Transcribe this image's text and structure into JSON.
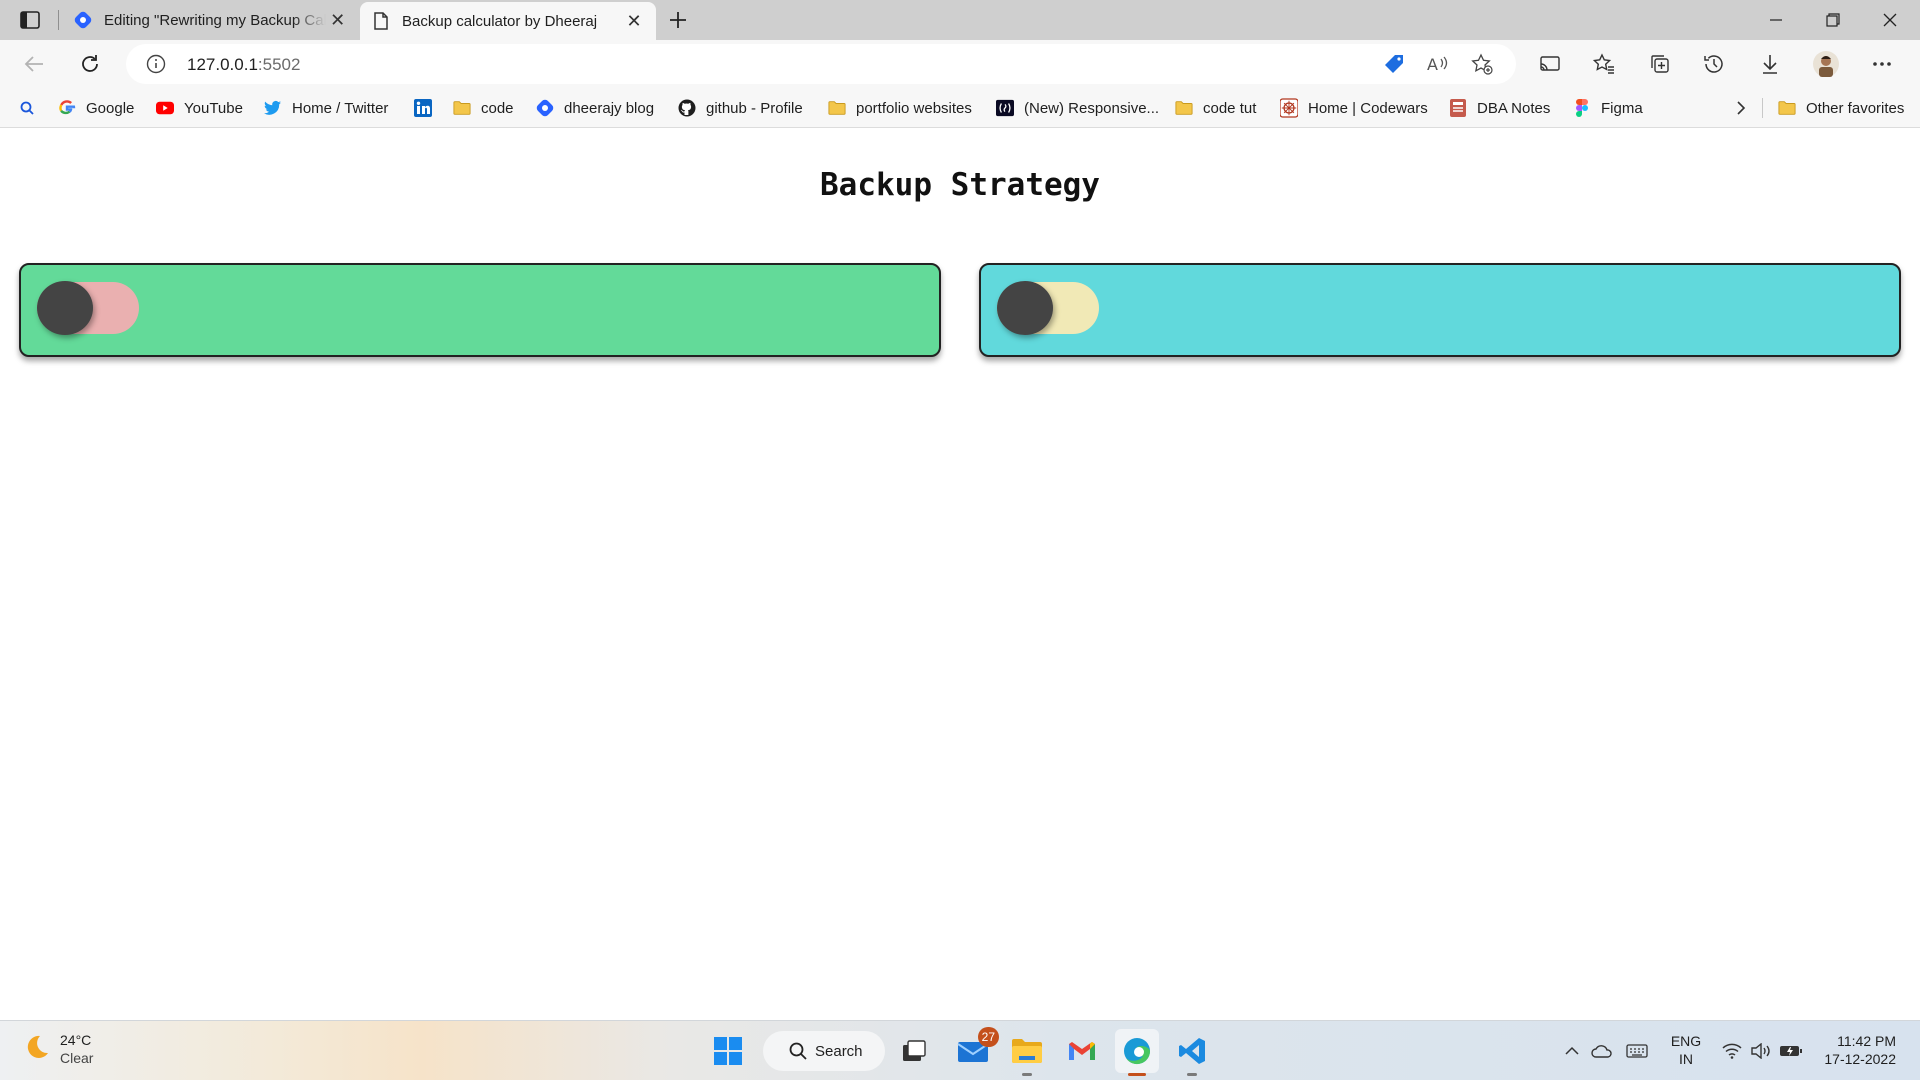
{
  "browser": {
    "tabs": [
      {
        "title": "Editing \"Rewriting my Backup Calculator\"",
        "favicon": "hashnode-icon",
        "active": false
      },
      {
        "title": "Backup calculator by Dheeraj",
        "favicon": "page-icon",
        "active": true
      }
    ],
    "address": {
      "host": "127.0.0.1",
      "port": ":5502"
    },
    "favorites": [
      {
        "label": "",
        "icon": "search-icon"
      },
      {
        "label": "Google",
        "icon": "google-icon"
      },
      {
        "label": "YouTube",
        "icon": "youtube-icon"
      },
      {
        "label": "Home / Twitter",
        "icon": "twitter-icon"
      },
      {
        "label": "",
        "icon": "linkedin-icon"
      },
      {
        "label": "code",
        "icon": "folder-icon"
      },
      {
        "label": "dheerajy blog",
        "icon": "hashnode-icon"
      },
      {
        "label": "github - Profile",
        "icon": "github-icon"
      },
      {
        "label": "portfolio websites",
        "icon": "folder-icon"
      },
      {
        "label": "(New) Responsive...",
        "icon": "freecodecamp-icon"
      },
      {
        "label": "code tut",
        "icon": "folder-icon"
      },
      {
        "label": "Home | Codewars",
        "icon": "codewars-icon"
      },
      {
        "label": "DBA Notes",
        "icon": "notes-icon"
      },
      {
        "label": "Figma",
        "icon": "figma-icon"
      }
    ],
    "other_favorites": "Other favorites"
  },
  "page": {
    "title": "Backup Strategy",
    "cards": [
      {
        "name": "card-left",
        "bg": "#63da99",
        "toggle_track": "#eab0b0",
        "toggle_on": false
      },
      {
        "name": "card-right",
        "bg": "#61d9dc",
        "toggle_track": "#f1e9b6",
        "toggle_on": false
      }
    ]
  },
  "taskbar": {
    "weather": {
      "temp": "24°C",
      "condition": "Clear"
    },
    "search_label": "Search",
    "mail_badge": "27",
    "lang": {
      "line1": "ENG",
      "line2": "IN"
    },
    "clock": {
      "time": "11:42 PM",
      "date": "17-12-2022"
    }
  }
}
